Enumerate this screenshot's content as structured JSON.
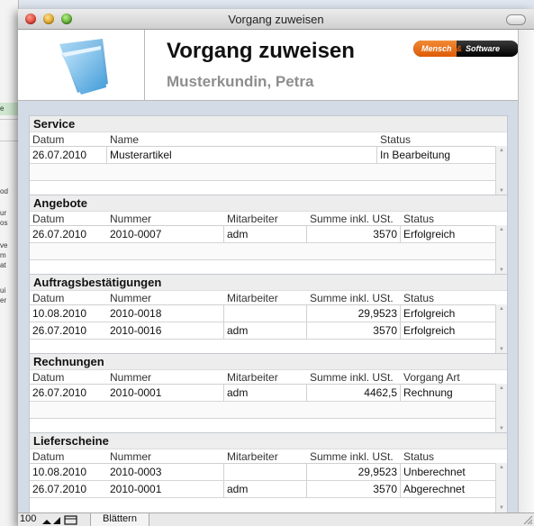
{
  "window": {
    "title": "Vorgang zuweisen"
  },
  "header": {
    "title": "Vorgang zuweisen",
    "customer": "Musterkundin, Petra",
    "brand_left": "Mensch",
    "brand_amp": "&",
    "brand_right": "Software"
  },
  "background_fragments": [
    "e",
    "od",
    "ur",
    "os",
    "ve",
    "m",
    "at",
    "ui",
    "er"
  ],
  "sections": {
    "service": {
      "title": "Service",
      "headers": [
        "Datum",
        "Name",
        "Status"
      ],
      "rows": [
        {
          "datum": "26.07.2010",
          "name": "Musterartikel",
          "status": "In Bearbeitung"
        }
      ]
    },
    "angebote": {
      "title": "Angebote",
      "headers": [
        "Datum",
        "Nummer",
        "Mitarbeiter",
        "Summe inkl. USt.",
        "Status"
      ],
      "rows": [
        {
          "datum": "26.07.2010",
          "nummer": "2010-0007",
          "mitarbeiter": "adm",
          "summe": "3570",
          "status": "Erfolgreich"
        }
      ]
    },
    "auftragsbestaetigungen": {
      "title": "Auftragsbestätigungen",
      "headers": [
        "Datum",
        "Nummer",
        "Mitarbeiter",
        "Summe inkl. USt.",
        "Status"
      ],
      "rows": [
        {
          "datum": "10.08.2010",
          "nummer": "2010-0018",
          "mitarbeiter": "",
          "summe": "29,9523",
          "status": "Erfolgreich"
        },
        {
          "datum": "26.07.2010",
          "nummer": "2010-0016",
          "mitarbeiter": "adm",
          "summe": "3570",
          "status": "Erfolgreich"
        }
      ]
    },
    "rechnungen": {
      "title": "Rechnungen",
      "headers": [
        "Datum",
        "Nummer",
        "Mitarbeiter",
        "Summe inkl. USt.",
        "Vorgang Art"
      ],
      "rows": [
        {
          "datum": "26.07.2010",
          "nummer": "2010-0001",
          "mitarbeiter": "adm",
          "summe": "4462,5",
          "status": "Rechnung"
        }
      ]
    },
    "lieferscheine": {
      "title": "Lieferscheine",
      "headers": [
        "Datum",
        "Nummer",
        "Mitarbeiter",
        "Summe inkl. USt.",
        "Status"
      ],
      "rows": [
        {
          "datum": "10.08.2010",
          "nummer": "2010-0003",
          "mitarbeiter": "",
          "summe": "29,9523",
          "status": "Unberechnet"
        },
        {
          "datum": "26.07.2010",
          "nummer": "2010-0001",
          "mitarbeiter": "adm",
          "summe": "3570",
          "status": "Abgerechnet"
        }
      ]
    }
  },
  "statusbar": {
    "zoom": "100",
    "mode": "Blättern"
  }
}
